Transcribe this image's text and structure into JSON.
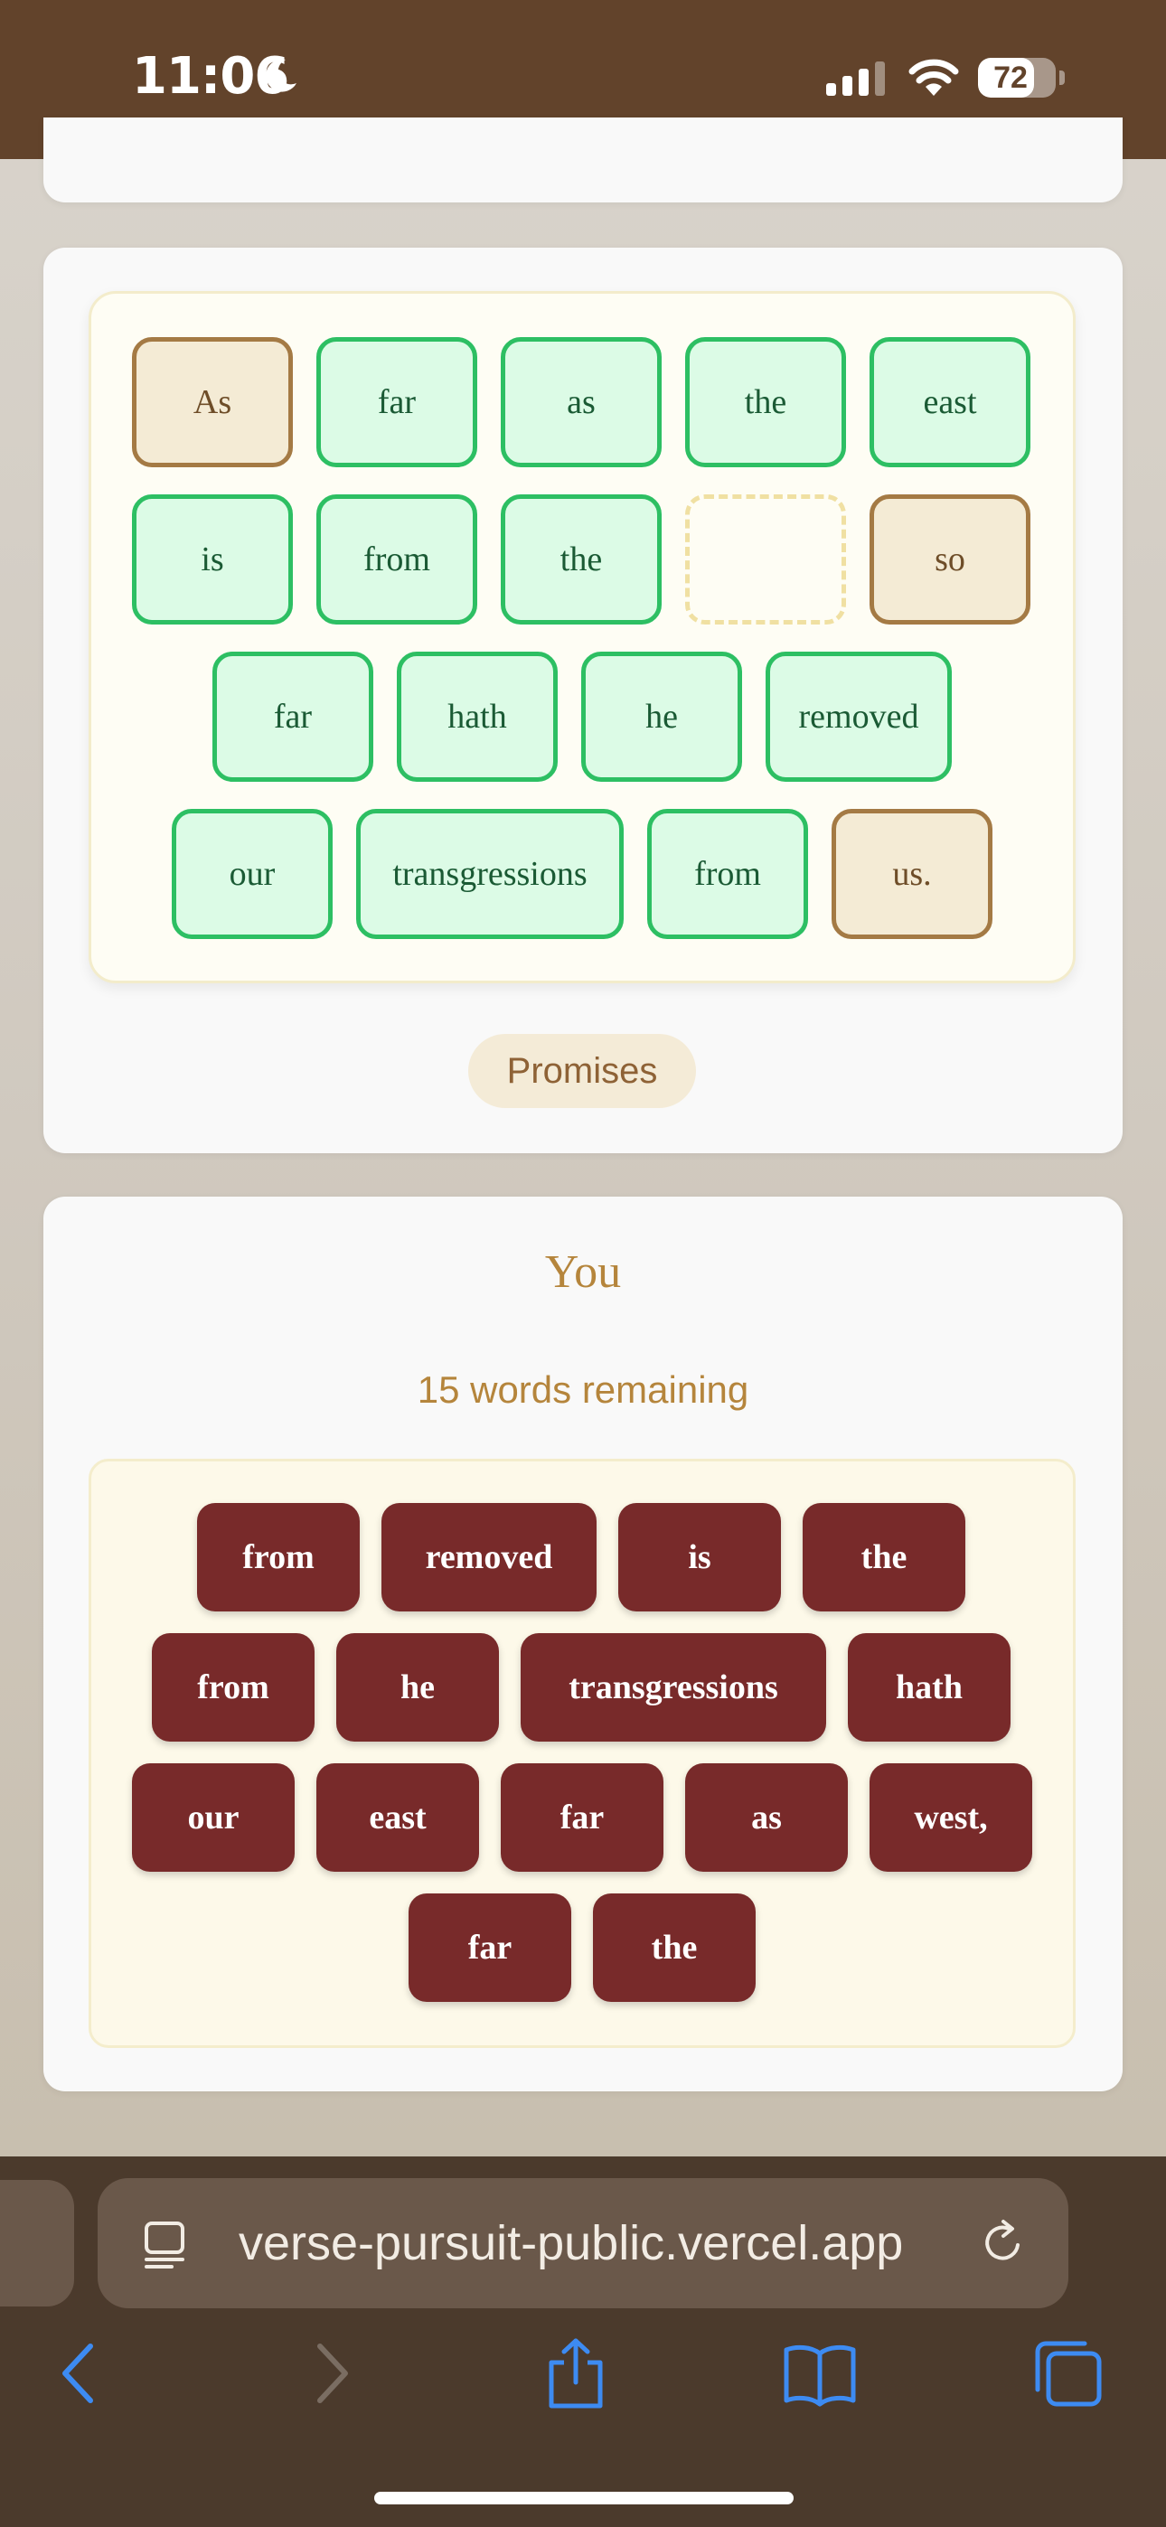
{
  "status_bar": {
    "time": "11:06",
    "battery": "72",
    "battery_level": 0.72
  },
  "puzzle": {
    "rows": [
      [
        {
          "text": "As",
          "state": "given"
        },
        {
          "text": "far",
          "state": "correct"
        },
        {
          "text": "as",
          "state": "correct"
        },
        {
          "text": "the",
          "state": "correct"
        },
        {
          "text": "east",
          "state": "correct"
        }
      ],
      [
        {
          "text": "is",
          "state": "correct"
        },
        {
          "text": "from",
          "state": "correct"
        },
        {
          "text": "the",
          "state": "correct"
        },
        {
          "text": "",
          "state": "empty"
        },
        {
          "text": "so",
          "state": "given"
        }
      ],
      [
        {
          "text": "far",
          "state": "correct"
        },
        {
          "text": "hath",
          "state": "correct"
        },
        {
          "text": "he",
          "state": "correct"
        },
        {
          "text": "removed",
          "state": "correct"
        }
      ],
      [
        {
          "text": "our",
          "state": "correct"
        },
        {
          "text": "transgressions",
          "state": "correct"
        },
        {
          "text": "from",
          "state": "correct"
        },
        {
          "text": "us.",
          "state": "given"
        }
      ]
    ],
    "category_chip": "Promises"
  },
  "player": {
    "title": "You",
    "remaining_text": "15 words remaining",
    "word_bank": [
      [
        "from",
        "removed",
        "is",
        "the"
      ],
      [
        "from",
        "he",
        "transgressions",
        "hath"
      ],
      [
        "our",
        "east",
        "far",
        "as",
        "west,"
      ],
      [
        "far",
        "the"
      ]
    ]
  },
  "browser": {
    "url": "verse-pursuit-public.vercel.app"
  },
  "colors": {
    "header": "#62432b",
    "correct_border": "#2dbf63",
    "given_border": "#a47a44",
    "word_tile": "#782a2a",
    "accent": "#b5853c"
  }
}
